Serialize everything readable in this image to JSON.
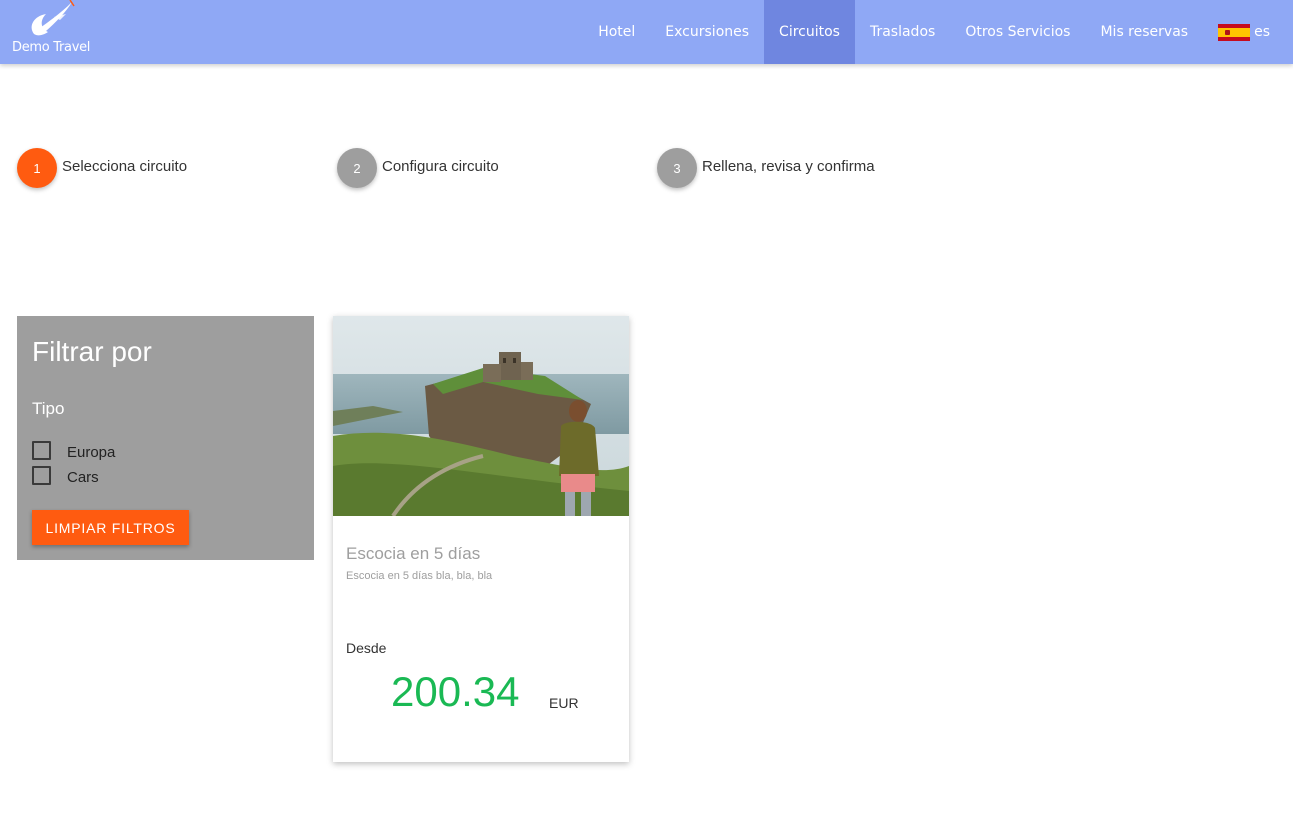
{
  "brand": {
    "name": "Demo Travel"
  },
  "nav": {
    "items": [
      {
        "label": "Hotel",
        "active": false
      },
      {
        "label": "Excursiones",
        "active": false
      },
      {
        "label": "Circuitos",
        "active": true
      },
      {
        "label": "Traslados",
        "active": false
      },
      {
        "label": "Otros Servicios",
        "active": false
      },
      {
        "label": "Mis reservas",
        "active": false
      }
    ],
    "language": {
      "code": "es",
      "flag_icon": "spain-flag-icon"
    }
  },
  "steps": [
    {
      "number": "1",
      "label": "Selecciona circuito",
      "active": true
    },
    {
      "number": "2",
      "label": "Configura circuito",
      "active": false
    },
    {
      "number": "3",
      "label": "Rellena, revisa y confirma",
      "active": false
    }
  ],
  "filter": {
    "title": "Filtrar por",
    "section_title": "Tipo",
    "options": [
      {
        "label": "Europa",
        "checked": false
      },
      {
        "label": "Cars",
        "checked": false
      }
    ],
    "clear_button": "Limpiar filtros"
  },
  "results": [
    {
      "title": "Escocia en 5 días",
      "description": "Escocia en 5 días bla, bla, bla",
      "from_label": "Desde",
      "price": "200.34",
      "currency": "EUR"
    }
  ],
  "colors": {
    "navbar": "#8fa8f5",
    "navbar_active": "#6f86e0",
    "accent": "#ff5b10",
    "step_inactive": "#9e9e9e",
    "filter_bg": "#9e9e9e",
    "price": "#1ab954"
  }
}
